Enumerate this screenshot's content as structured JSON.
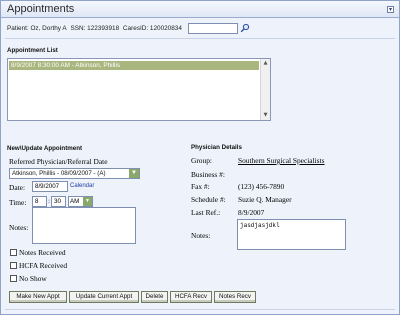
{
  "window": {
    "title": "Appointments"
  },
  "patient": {
    "patient_text": "Patient: Oz, Dorthy A",
    "ssn_text": "SSN: 122393918",
    "caresid_text": "CaresID: 120020834",
    "search_value": ""
  },
  "appointment_list": {
    "label": "Appointment List",
    "items": [
      {
        "text": "8/9/2007 8:30:00 AM - Atkinson, Phillis",
        "selected": true
      }
    ]
  },
  "update": {
    "label": "New\\Update Appointment",
    "referred_label": "Referred Physician/Referral Date",
    "referred_value": "Atkinson, Phillis - 08/09/2007 - (A)",
    "date_label": "Date:",
    "date_value": "8/9/2007",
    "calendar_link": "Calendar",
    "time_label": "Time:",
    "time_hour": "8",
    "time_minute": "30",
    "time_ampm": "AM",
    "notes_label": "Notes:",
    "notes_value": "",
    "checkboxes": [
      {
        "label": "Notes Received",
        "checked": false
      },
      {
        "label": "HCFA Received",
        "checked": false
      },
      {
        "label": "No Show",
        "checked": false
      }
    ]
  },
  "physician": {
    "label": "Physician Details",
    "group_label": "Group:",
    "group_value": "Southern Surgical Specialists",
    "business_label": "Business #:",
    "business_value": "",
    "fax_label": "Fax #:",
    "fax_value": "(123) 456-7890",
    "schedule_label": "Schedule #:",
    "schedule_value": "Suzie Q. Manager",
    "lastref_label": "Last Ref.:",
    "lastref_value": "8/9/2007",
    "notes_label": "Notes:",
    "notes_value": "jasdjasjdkl"
  },
  "buttons": {
    "make_new": "Make New Appt",
    "update_current": "Update Current Appt",
    "delete": "Delete",
    "hcfa_recv": "HCFA Recv",
    "notes_recv": "Notes Recv"
  }
}
